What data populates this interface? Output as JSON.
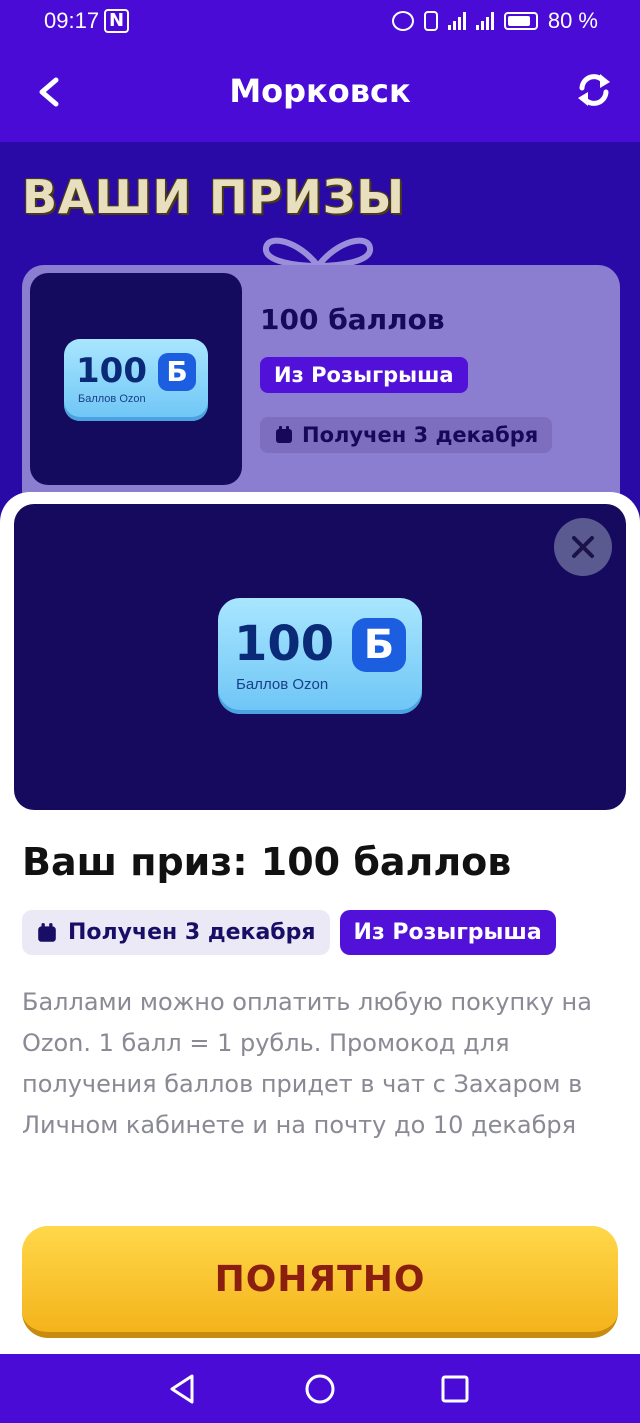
{
  "status_bar": {
    "time": "09:17",
    "nfc": "N",
    "battery": "80 %"
  },
  "header": {
    "title": "Морковск",
    "back_icon": "chevron-left-icon",
    "refresh_icon": "refresh-icon"
  },
  "prizes": {
    "title": "ВАШИ ПРИЗЫ",
    "card": {
      "name": "100 баллов",
      "source": "Из Розыгрыша",
      "date": "Получен 3 декабря",
      "logo_number": "100",
      "logo_letter": "Б",
      "logo_caption": "Баллов Ozon"
    }
  },
  "sheet": {
    "logo_number": "100",
    "logo_letter": "Б",
    "logo_caption": "Баллов Ozon",
    "title": "Ваш приз: 100 баллов",
    "date_badge": "Получен 3 декабря",
    "source_badge": "Из Розыгрыша",
    "description": "Баллами можно оплатить любую покупку на Ozon. 1 балл = 1 рубль. Промокод для получения баллов придет в чат с Захаром в Личном кабинете и на почту до 10 декабря",
    "ok_label": "ПОНЯТНО"
  },
  "colors": {
    "accent": "#4a0bd6",
    "badge": "#5211d8",
    "button": "#f4b31b",
    "banner": "#150a5e"
  }
}
